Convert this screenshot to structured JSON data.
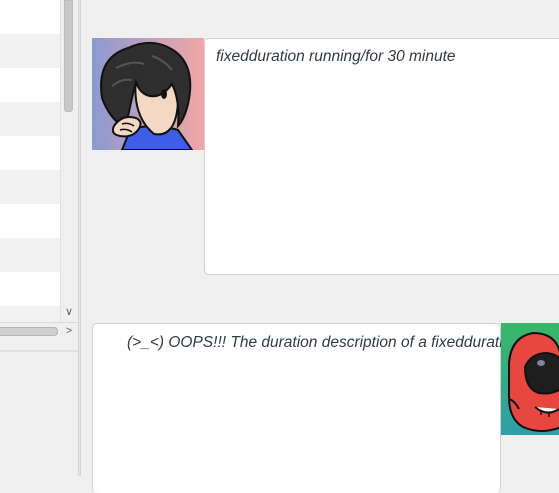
{
  "chat": {
    "messages": [
      {
        "sender": "user",
        "avatar_icon": "user-avatar-icon",
        "text": "fixedduration running/for 30 minute"
      },
      {
        "sender": "bot",
        "avatar_icon": "bot-avatar-icon",
        "text": "(>_<) OOPS!!! The duration description of a fixedduration task"
      }
    ]
  },
  "scrollbar": {
    "down_arrow": "∨",
    "right_arrow": ">"
  },
  "colors": {
    "background": "#f0f0f0",
    "bubble": "#ffffff",
    "bubble_border": "#d0d0d0",
    "user_avatar_bg_left": "#8a9bd1",
    "user_avatar_bg_right": "#f2a6a6",
    "bot_avatar_bg": "#3bb36a",
    "bot_face": "#e8473f"
  }
}
